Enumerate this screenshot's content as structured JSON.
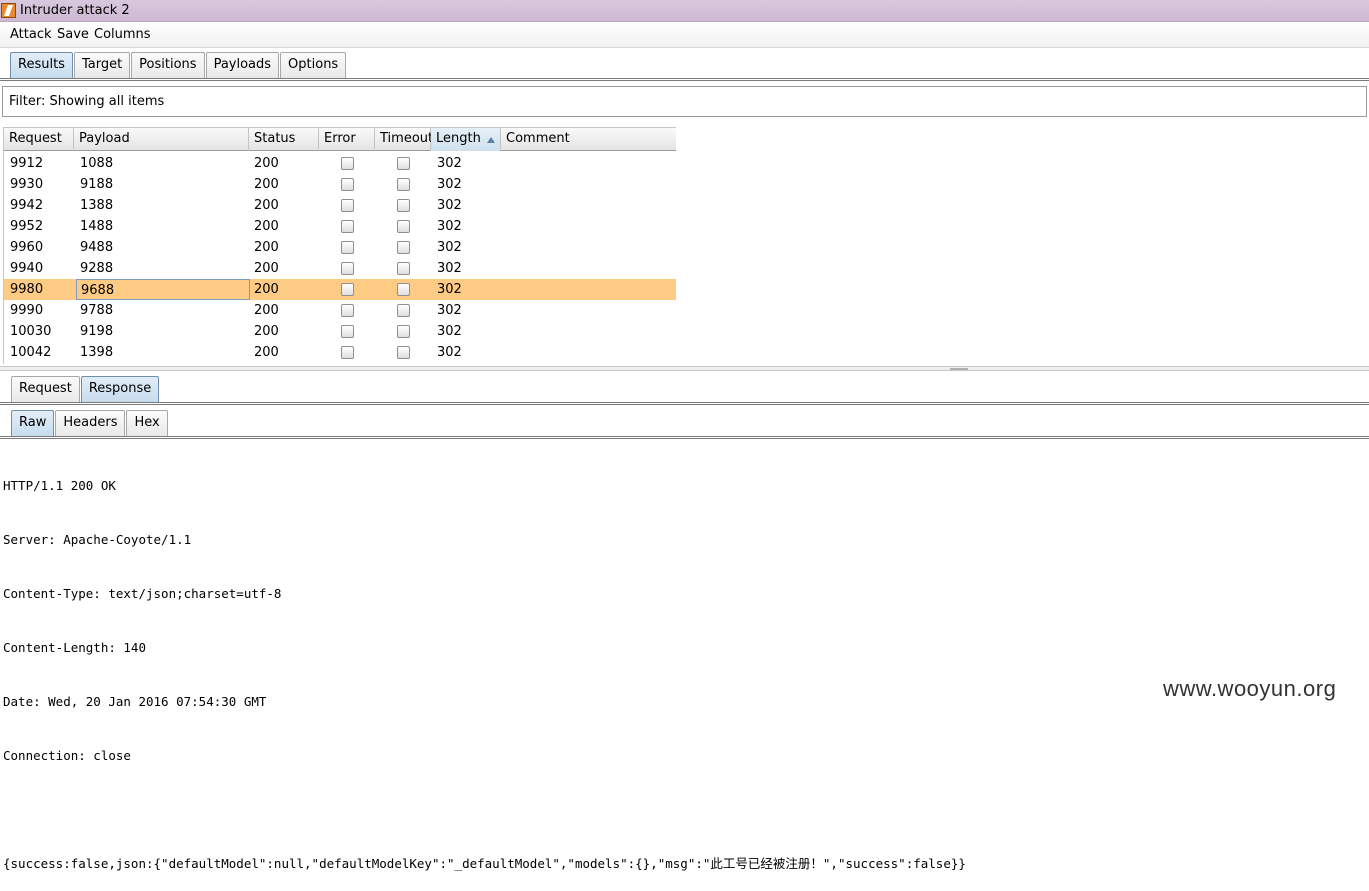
{
  "window": {
    "title": "Intruder attack 2"
  },
  "menu": {
    "items": [
      "Attack",
      "Save",
      "Columns"
    ]
  },
  "main_tabs": [
    {
      "label": "Results",
      "active": true
    },
    {
      "label": "Target",
      "active": false
    },
    {
      "label": "Positions",
      "active": false
    },
    {
      "label": "Payloads",
      "active": false
    },
    {
      "label": "Options",
      "active": false
    }
  ],
  "filter": {
    "text": "Filter: Showing all items"
  },
  "table": {
    "columns": [
      "Request",
      "Payload",
      "Status",
      "Error",
      "Timeout",
      "Length",
      "Comment"
    ],
    "sorted_column": "Length",
    "rows": [
      {
        "request": "9912",
        "payload": "1088",
        "status": "200",
        "error": false,
        "timeout": false,
        "length": "302",
        "comment": ""
      },
      {
        "request": "9930",
        "payload": "9188",
        "status": "200",
        "error": false,
        "timeout": false,
        "length": "302",
        "comment": ""
      },
      {
        "request": "9942",
        "payload": "1388",
        "status": "200",
        "error": false,
        "timeout": false,
        "length": "302",
        "comment": ""
      },
      {
        "request": "9952",
        "payload": "1488",
        "status": "200",
        "error": false,
        "timeout": false,
        "length": "302",
        "comment": ""
      },
      {
        "request": "9960",
        "payload": "9488",
        "status": "200",
        "error": false,
        "timeout": false,
        "length": "302",
        "comment": ""
      },
      {
        "request": "9940",
        "payload": "9288",
        "status": "200",
        "error": false,
        "timeout": false,
        "length": "302",
        "comment": ""
      },
      {
        "request": "9980",
        "payload": "9688",
        "status": "200",
        "error": false,
        "timeout": false,
        "length": "302",
        "comment": "",
        "selected": true
      },
      {
        "request": "9990",
        "payload": "9788",
        "status": "200",
        "error": false,
        "timeout": false,
        "length": "302",
        "comment": ""
      },
      {
        "request": "10030",
        "payload": "9198",
        "status": "200",
        "error": false,
        "timeout": false,
        "length": "302",
        "comment": ""
      },
      {
        "request": "10042",
        "payload": "1398",
        "status": "200",
        "error": false,
        "timeout": false,
        "length": "302",
        "comment": ""
      }
    ]
  },
  "detail_tabs": [
    {
      "label": "Request",
      "active": false
    },
    {
      "label": "Response",
      "active": true
    }
  ],
  "view_tabs": [
    {
      "label": "Raw",
      "active": true
    },
    {
      "label": "Headers",
      "active": false
    },
    {
      "label": "Hex",
      "active": false
    }
  ],
  "response": {
    "lines": [
      "HTTP/1.1 200 OK",
      "Server: Apache-Coyote/1.1",
      "Content-Type: text/json;charset=utf-8",
      "Content-Length: 140",
      "Date: Wed, 20 Jan 2016 07:54:30 GMT",
      "Connection: close",
      "",
      "{success:false,json:{\"defaultModel\":null,\"defaultModelKey\":\"_defaultModel\",\"models\":{},\"msg\":\"此工号已经被注册！\",\"success\":false}}"
    ]
  },
  "watermark": "www.wooyun.org",
  "colors": {
    "selected_row": "#fdcb84",
    "active_tab": "#c6dcee"
  }
}
